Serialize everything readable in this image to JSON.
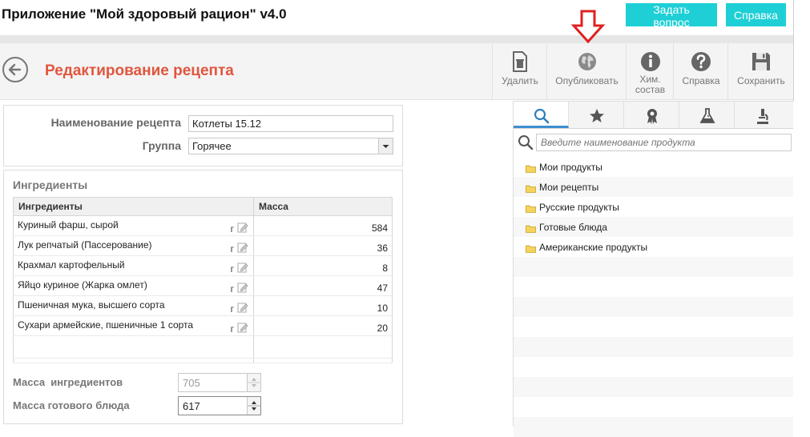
{
  "app": {
    "title": "Приложение \"Мой здоровый рацион\" v4.0"
  },
  "header": {
    "ask_label": "Задать вопрос",
    "help_label": "Справка"
  },
  "toolbar": {
    "page_title": "Редактирование рецепта",
    "delete_label": "Удалить",
    "publish_label": "Опубликовать",
    "chem_label_1": "Хим.",
    "chem_label_2": "состав",
    "help_label": "Справка",
    "save_label": "Сохранить"
  },
  "recipe": {
    "name_label": "Наименование рецепта",
    "name_value": "Котлеты 15.12",
    "group_label": "Группа",
    "group_value": "Горячее"
  },
  "ingredients": {
    "title": "Ингредиенты",
    "col_name": "Ингредиенты",
    "col_mass": "Масса",
    "unit": "г",
    "rows": [
      {
        "name": "Куриный фарш, сырой",
        "mass": "584"
      },
      {
        "name": "Лук репчатый (Пассерование)",
        "mass": "36"
      },
      {
        "name": "Крахмал картофельный",
        "mass": "8"
      },
      {
        "name": "Яйцо куриное (Жарка омлет)",
        "mass": "47"
      },
      {
        "name": "Пшеничная мука, высшего сорта",
        "mass": "10"
      },
      {
        "name": "Сухари армейские, пшеничные 1 сорта",
        "mass": "20"
      }
    ]
  },
  "totals": {
    "ingredients_mass_label": "Масса  ингредиентов",
    "ingredients_mass_value": "705",
    "dish_mass_label": "Масса готового блюда",
    "dish_mass_value": "617"
  },
  "right": {
    "search_placeholder": "Введите наименование продукта",
    "folders": [
      "Мои продукты",
      "Мои рецепты",
      "Русские продукты",
      "Готовые блюда",
      "Американские продукты"
    ]
  },
  "colors": {
    "accent": "#1ecfd6",
    "title_red": "#e0563e",
    "tab_active": "#3d8fd1",
    "arrow_red": "#e02020"
  }
}
